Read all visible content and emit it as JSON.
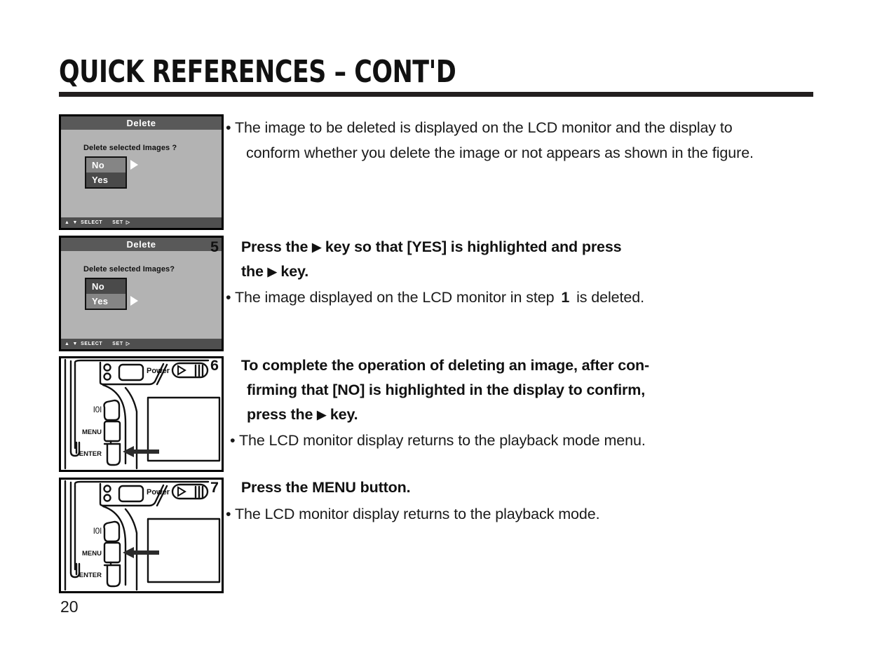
{
  "page": {
    "title": "QUICK REFERENCES – CONT'D",
    "number": "20"
  },
  "colors": {
    "rule": "#231f1f",
    "lcd_body": "#b3b3b3",
    "lcd_titlebar": "#595959",
    "lcd_statusbar": "#4f4f4f",
    "choice_highlighted": "#858585",
    "choice_dim": "#4a4a4a",
    "ink": "#111111"
  },
  "figures": {
    "lcd_no_selected": {
      "title": "Delete",
      "question": "Delete selected Images ?",
      "choices": [
        {
          "label": "No",
          "highlighted": true
        },
        {
          "label": "Yes",
          "highlighted": false
        }
      ],
      "cursor_on": "No",
      "statusbar": {
        "up_glyph": "▲",
        "down_glyph": "▼",
        "select_label": "SELECT",
        "set_label": "SET",
        "set_glyph": "▷"
      }
    },
    "lcd_yes_selected": {
      "title": "Delete",
      "question": "Delete selected Images?",
      "choices": [
        {
          "label": "No",
          "highlighted": false
        },
        {
          "label": "Yes",
          "highlighted": true
        }
      ],
      "cursor_on": "Yes",
      "statusbar": {
        "up_glyph": "▲",
        "down_glyph": "▼",
        "select_label": "SELECT",
        "set_label": "SET",
        "set_glyph": "▷"
      }
    },
    "camera_enter": {
      "power_label": "Power",
      "display_label": "l0l",
      "menu_label": "MENU",
      "enter_label": "ENTER",
      "arrow_points_to": "ENTER"
    },
    "camera_menu": {
      "power_label": "Power",
      "display_label": "l0l",
      "menu_label": "MENU",
      "enter_label": "ENTER",
      "arrow_points_to": "MENU"
    }
  },
  "content": {
    "intro_bullet": {
      "marker": "•",
      "line1": "The image to be deleted is displayed on the LCD monitor and the display to",
      "line2": "conform whether you delete the image or not appears as shown in the figure."
    },
    "step5": {
      "number": "5",
      "head_line1_a": "Press the",
      "head_arrow": "▶",
      "head_line1_b": "key so that [YES] is highlighted and press",
      "head_line2_a": "the",
      "head_line2_b": "key.",
      "bullet_marker": "•",
      "bullet_a": "The image displayed on the LCD monitor in step",
      "bullet_ref": "1",
      "bullet_b": "is deleted."
    },
    "step6": {
      "number": "6",
      "head_line1": "To complete the operation of deleting an image, after con-",
      "head_line2": "firming that [NO] is highlighted in the display to confirm,",
      "head_line3_a": "press the",
      "head_arrow": "▶",
      "head_line3_b": "key.",
      "bullet_marker": "•",
      "bullet": "The LCD monitor display returns to the playback mode menu."
    },
    "step7": {
      "number": "7",
      "head": "Press the MENU button.",
      "bullet_marker": "•",
      "bullet": "The LCD monitor display returns to the playback mode."
    }
  }
}
